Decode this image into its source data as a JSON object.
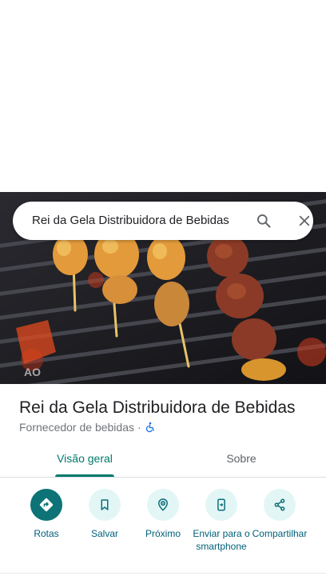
{
  "search": {
    "query": "Rei da Gela Distribuidora de Bebidas"
  },
  "place": {
    "name": "Rei da Gela Distribuidora de Bebidas",
    "category": "Fornecedor de bebidas",
    "separator": "·",
    "accessibility_icon": "wheelchair-icon"
  },
  "tabs": [
    {
      "label": "Visão geral",
      "selected": true
    },
    {
      "label": "Sobre",
      "selected": false
    }
  ],
  "actions": [
    {
      "label": "Rotas",
      "icon": "directions-icon"
    },
    {
      "label": "Salvar",
      "icon": "bookmark-icon"
    },
    {
      "label": "Próximo",
      "icon": "nearby-icon"
    },
    {
      "label": "Enviar para o smartphone",
      "icon": "send-to-phone-icon"
    },
    {
      "label": "Compartilhar",
      "icon": "share-icon"
    }
  ],
  "colors": {
    "accent": "#00796b",
    "action_primary": "#0d7377",
    "action_bg": "#e3f6f6",
    "action_label": "#00607a"
  }
}
